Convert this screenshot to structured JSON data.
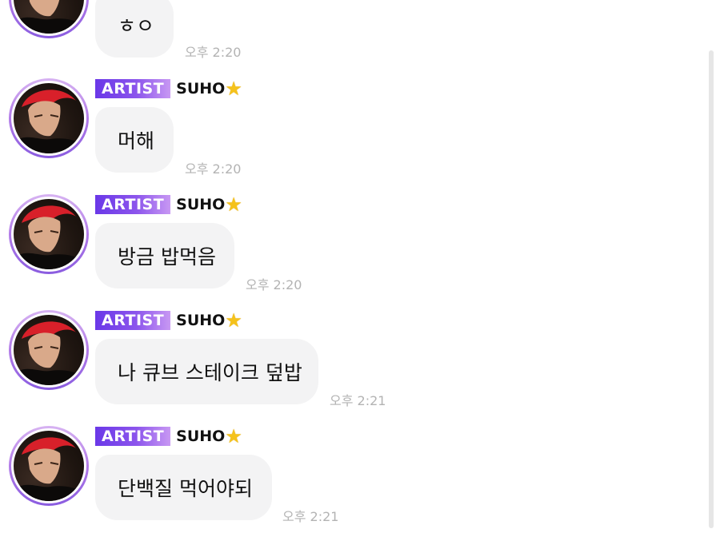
{
  "messages": [
    {
      "badge": "",
      "name": "",
      "text": "ㅎㅇ",
      "time": "오후 2:20"
    },
    {
      "badge": "ARTIST",
      "name": "SUHO",
      "text": "머해",
      "time": "오후 2:20"
    },
    {
      "badge": "ARTIST",
      "name": "SUHO",
      "text": "방금 밥먹음",
      "time": "오후 2:20"
    },
    {
      "badge": "ARTIST",
      "name": "SUHO",
      "text": "나 큐브 스테이크 덮밥",
      "time": "오후 2:21"
    },
    {
      "badge": "ARTIST",
      "name": "SUHO",
      "text": "단백질 먹어야되",
      "time": "오후 2:21"
    }
  ],
  "icons": {
    "star": "star-icon"
  },
  "colors": {
    "badge_start": "#6a38e8",
    "badge_end": "#c898f3",
    "bubble": "#f3f3f4",
    "timestamp": "#b3b3b3",
    "avatar_ring": "#b27be8"
  }
}
